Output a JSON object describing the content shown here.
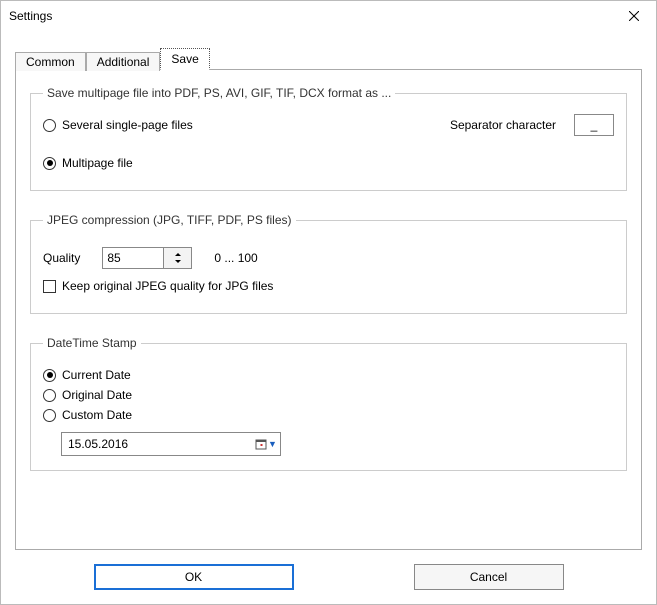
{
  "window": {
    "title": "Settings"
  },
  "tabs": {
    "common": "Common",
    "additional": "Additional",
    "save": "Save"
  },
  "multipage": {
    "legend": "Save multipage file into PDF, PS, AVI, GIF, TIF, DCX format as ...",
    "opt_several": "Several single-page files",
    "opt_multipage": "Multipage file",
    "separator_label": "Separator character",
    "separator_value": "_"
  },
  "jpeg": {
    "legend": "JPEG compression (JPG, TIFF, PDF, PS files)",
    "quality_label": "Quality",
    "quality_value": "85",
    "quality_range": "0 ... 100",
    "keep_original": "Keep original JPEG quality for JPG files"
  },
  "datetime": {
    "legend": "DateTime Stamp",
    "opt_current": "Current Date",
    "opt_original": "Original Date",
    "opt_custom": "Custom Date",
    "custom_value": "15.05.2016"
  },
  "buttons": {
    "ok": "OK",
    "cancel": "Cancel"
  }
}
